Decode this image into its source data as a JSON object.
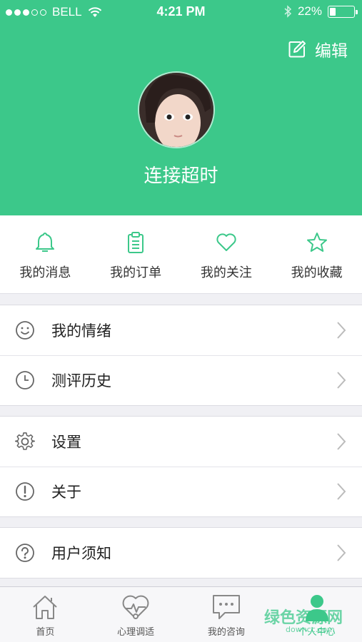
{
  "status_bar": {
    "carrier": "BELL",
    "time": "4:21 PM",
    "battery": "22%",
    "battery_level": 0.22
  },
  "header": {
    "edit_label": "编辑",
    "username": "连接超时",
    "accent": "#3cc88a"
  },
  "quick_actions": [
    {
      "label": "我的消息",
      "icon": "bell-icon"
    },
    {
      "label": "我的订单",
      "icon": "clipboard-icon"
    },
    {
      "label": "我的关注",
      "icon": "heart-icon"
    },
    {
      "label": "我的收藏",
      "icon": "star-icon"
    }
  ],
  "menu": {
    "mood": "我的情绪",
    "history": "测评历史",
    "settings": "设置",
    "about": "关于",
    "notice": "用户须知"
  },
  "tabs": [
    {
      "label": "首页",
      "icon": "home-icon"
    },
    {
      "label": "心理调适",
      "icon": "heart-pulse-icon"
    },
    {
      "label": "我的咨询",
      "icon": "chat-icon"
    },
    {
      "label": "个人中心",
      "icon": "person-icon",
      "active": true
    }
  ],
  "watermark": {
    "text": "绿色资源网",
    "sub": "downcc.com"
  }
}
